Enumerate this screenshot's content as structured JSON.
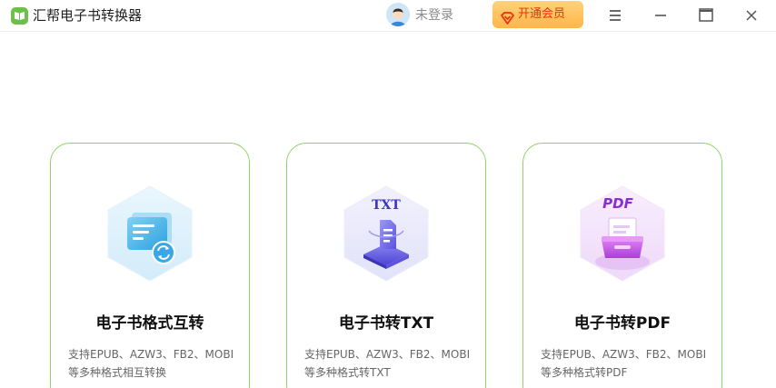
{
  "app": {
    "title": "汇帮电子书转换器",
    "accent": "#6cc04a"
  },
  "header": {
    "login_text": "未登录",
    "vip_label": "开通会员"
  },
  "cards": [
    {
      "title": "电子书格式互转",
      "desc_line1": "支持EPUB、AZW3、FB2、MOBI",
      "desc_line2": "等多种格式相互转换",
      "icon": "ebook-convert-icon"
    },
    {
      "title": "电子书转TXT",
      "desc_line1": "支持EPUB、AZW3、FB2、MOBI",
      "desc_line2": "等多种格式转TXT",
      "icon": "txt-icon",
      "icon_text": "TXT"
    },
    {
      "title": "电子书转PDF",
      "desc_line1": "支持EPUB、AZW3、FB2、MOBI",
      "desc_line2": "等多种格式转PDF",
      "icon": "pdf-icon",
      "icon_text": "PDF"
    }
  ]
}
